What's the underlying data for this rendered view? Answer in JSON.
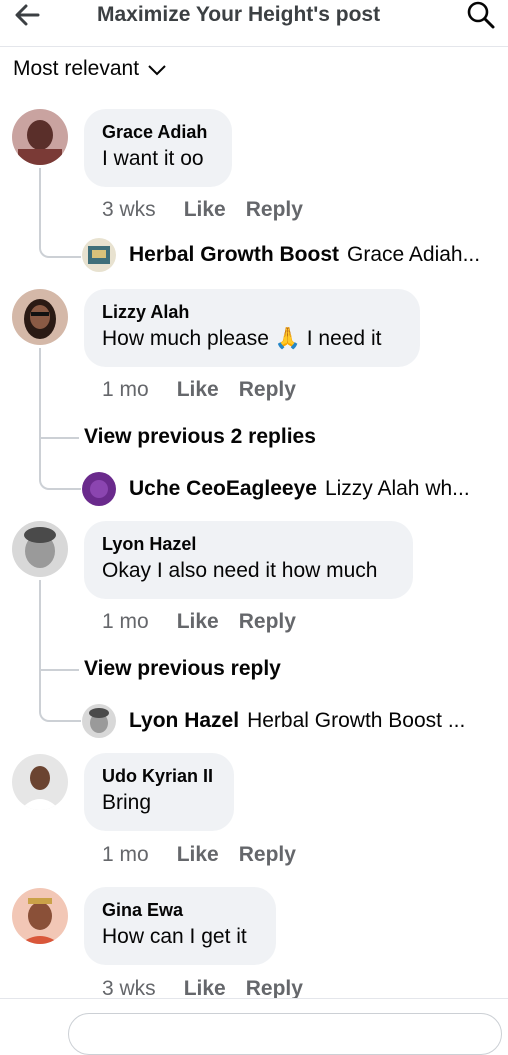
{
  "header": {
    "title": "Maximize Your Height's post"
  },
  "sort": {
    "label": "Most relevant"
  },
  "comments": [
    {
      "author": "Grace Adiah",
      "text": "I want it oo",
      "time": "3 wks",
      "like": "Like",
      "reply": "Reply",
      "reply_preview": {
        "author": "Herbal Growth Boost",
        "text": "Grace Adiah..."
      }
    },
    {
      "author": "Lizzy Alah",
      "text": "How much please 🙏 I need it",
      "time": "1 mo",
      "like": "Like",
      "reply": "Reply",
      "view_previous": "View previous 2 replies",
      "reply_preview": {
        "author": "Uche CeoEagleeye",
        "text": "Lizzy Alah wh..."
      }
    },
    {
      "author": "Lyon Hazel",
      "text": "Okay I also need it how much",
      "time": "1 mo",
      "like": "Like",
      "reply": "Reply",
      "view_previous": "View previous reply",
      "reply_preview": {
        "author": "Lyon Hazel",
        "text": "Herbal Growth Boost ..."
      }
    },
    {
      "author": "Udo Kyrian II",
      "text": "Bring",
      "time": "1 mo",
      "like": "Like",
      "reply": "Reply"
    },
    {
      "author": "Gina Ewa",
      "text": "How can I get it",
      "time": "3 wks",
      "like": "Like",
      "reply": "Reply"
    }
  ],
  "icons": {
    "back": "arrow-left-icon",
    "search": "search-icon",
    "sort": "chevron-down-icon"
  },
  "colors": {
    "bubble": "#f0f2f5",
    "meta_text": "#65676b",
    "thread_line": "#ccd0d5"
  }
}
